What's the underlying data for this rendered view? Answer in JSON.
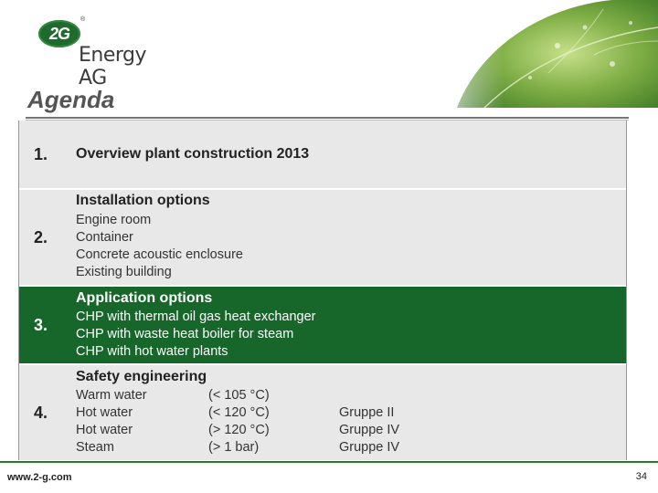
{
  "logo": {
    "mark": "2G",
    "reg": "®",
    "name": "Energy AG"
  },
  "title": "Agenda",
  "rows": [
    {
      "num": "1.",
      "heading": "Overview plant construction 2013"
    },
    {
      "num": "2.",
      "heading": "Installation options",
      "items": [
        "Engine room",
        "Container",
        "Concrete acoustic enclosure",
        "Existing building"
      ]
    },
    {
      "num": "3.",
      "heading": "Application options",
      "items": [
        "CHP with thermal oil gas heat exchanger",
        "CHP with waste heat boiler for steam",
        "CHP with hot water plants"
      ]
    },
    {
      "num": "4.",
      "heading": "Safety engineering",
      "media": [
        "Warm water",
        "Hot water",
        "Hot water",
        "Steam"
      ],
      "conditions": [
        "(< 105 °C)",
        "(< 120 °C)",
        "(> 120 °C)",
        "(> 1 bar)"
      ],
      "groups": [
        "",
        "Gruppe II",
        "Gruppe IV",
        "Gruppe IV"
      ]
    }
  ],
  "footer": {
    "url": "www.2-g.com",
    "page": "34"
  },
  "colors": {
    "brand_green": "#17662a",
    "row_gray": "#e8e8e8"
  }
}
